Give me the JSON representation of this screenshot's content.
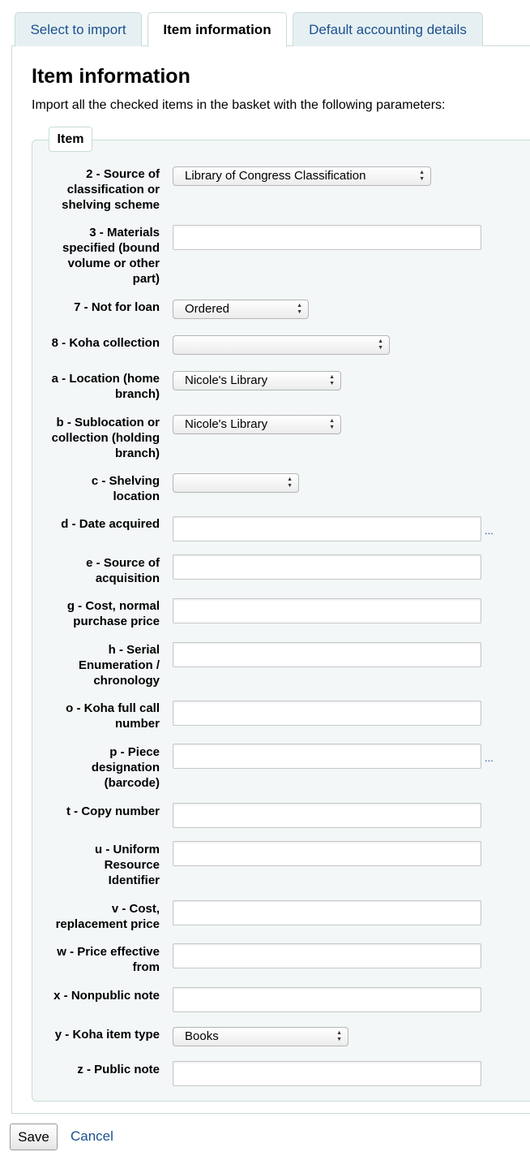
{
  "tabs": [
    {
      "label": "Select to import"
    },
    {
      "label": "Item information"
    },
    {
      "label": "Default accounting details"
    }
  ],
  "title": "Item information",
  "intro": "Import all the checked items in the basket with the following parameters:",
  "legend": "Item",
  "fields": {
    "f2": {
      "label": "2 - Source of classification or shelving scheme",
      "value": "Library of Congress Classification"
    },
    "f3": {
      "label": "3 - Materials specified (bound volume or other part)",
      "value": ""
    },
    "f7": {
      "label": "7 - Not for loan",
      "value": "Ordered"
    },
    "f8": {
      "label": "8 - Koha collection",
      "value": ""
    },
    "fa": {
      "label": "a - Location (home branch)",
      "value": "Nicole's Library"
    },
    "fb": {
      "label": "b - Sublocation or collection (holding branch)",
      "value": "Nicole's Library"
    },
    "fc": {
      "label": "c - Shelving location",
      "value": ""
    },
    "fd": {
      "label": "d - Date acquired",
      "value": "",
      "extra": "..."
    },
    "fe": {
      "label": "e - Source of acquisition",
      "value": ""
    },
    "fg": {
      "label": "g - Cost, normal purchase price",
      "value": ""
    },
    "fh": {
      "label": "h - Serial Enumeration / chronology",
      "value": ""
    },
    "fo": {
      "label": "o - Koha full call number",
      "value": ""
    },
    "fp": {
      "label": "p - Piece designation (barcode)",
      "value": "",
      "extra": "..."
    },
    "ft": {
      "label": "t - Copy number",
      "value": ""
    },
    "fu": {
      "label": "u - Uniform Resource Identifier",
      "value": ""
    },
    "fv": {
      "label": "v - Cost, replacement price",
      "value": ""
    },
    "fw": {
      "label": "w - Price effective from",
      "value": ""
    },
    "fx": {
      "label": "x - Nonpublic note",
      "value": ""
    },
    "fy": {
      "label": "y - Koha item type",
      "value": "Books"
    },
    "fz": {
      "label": "z - Public note",
      "value": ""
    }
  },
  "actions": {
    "save": "Save",
    "cancel": "Cancel"
  }
}
